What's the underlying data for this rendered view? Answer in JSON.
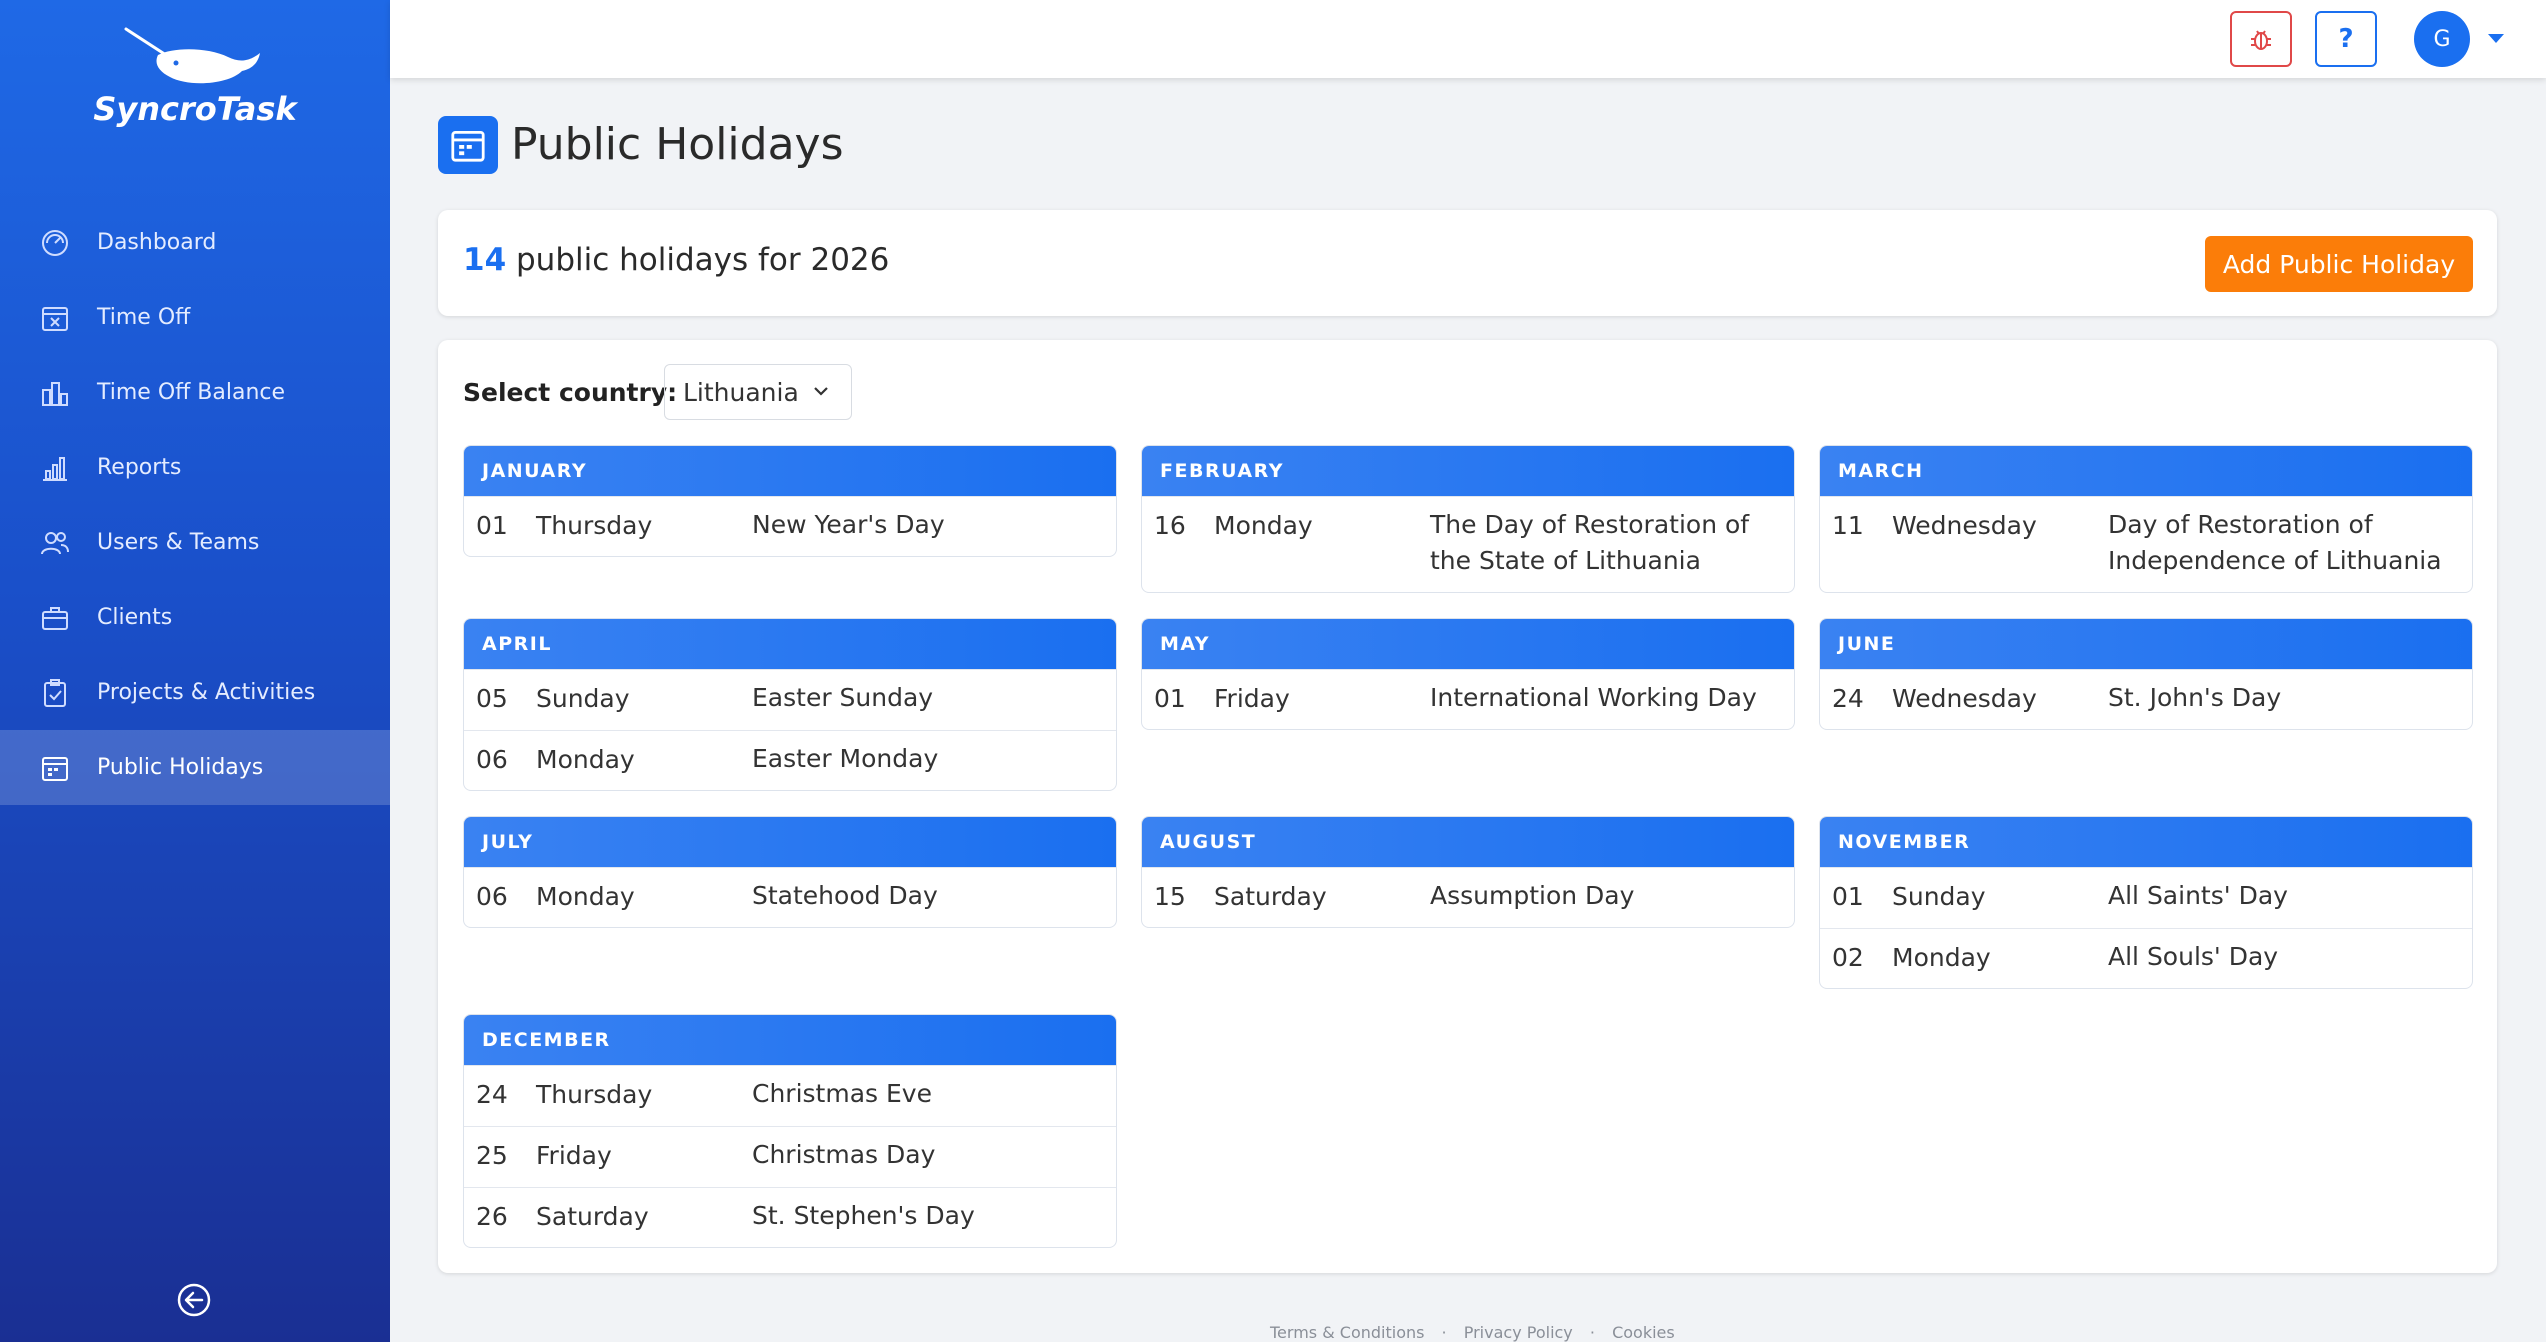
{
  "app": {
    "name": "SyncroTask"
  },
  "sidebar": {
    "items": [
      {
        "label": "Dashboard",
        "icon": "gauge-icon",
        "active": false
      },
      {
        "label": "Time Off",
        "icon": "calendar-x-icon",
        "active": false
      },
      {
        "label": "Time Off Balance",
        "icon": "balance-icon",
        "active": false
      },
      {
        "label": "Reports",
        "icon": "bar-chart-icon",
        "active": false
      },
      {
        "label": "Users & Teams",
        "icon": "users-icon",
        "active": false
      },
      {
        "label": "Clients",
        "icon": "briefcase-icon",
        "active": false
      },
      {
        "label": "Projects & Activities",
        "icon": "clipboard-check-icon",
        "active": false
      },
      {
        "label": "Public Holidays",
        "icon": "calendar-grid-icon",
        "active": true
      }
    ],
    "collapse_icon": "arrow-left-circle-icon"
  },
  "header": {
    "help_label": "?",
    "avatar_initial": "G",
    "colors": {
      "bug": "#e04848",
      "accent": "#1a6ff0"
    }
  },
  "page": {
    "title": "Public Holidays"
  },
  "summary": {
    "count": "14",
    "text": "public holidays for 2026",
    "add_button": "Add Public Holiday",
    "button_color": "#fb7d09"
  },
  "filter": {
    "label": "Select country:",
    "value": "Lithuania"
  },
  "months": [
    {
      "name": "JANUARY",
      "holidays": [
        {
          "day": "01",
          "weekday": "Thursday",
          "name": "New Year's Day"
        }
      ]
    },
    {
      "name": "FEBRUARY",
      "holidays": [
        {
          "day": "16",
          "weekday": "Monday",
          "name": "The Day of Restoration of the State of Lithuania"
        }
      ]
    },
    {
      "name": "MARCH",
      "holidays": [
        {
          "day": "11",
          "weekday": "Wednesday",
          "name": "Day of Restoration of Independence of Lithuania"
        }
      ]
    },
    {
      "name": "APRIL",
      "holidays": [
        {
          "day": "05",
          "weekday": "Sunday",
          "name": "Easter Sunday"
        },
        {
          "day": "06",
          "weekday": "Monday",
          "name": "Easter Monday"
        }
      ]
    },
    {
      "name": "MAY",
      "holidays": [
        {
          "day": "01",
          "weekday": "Friday",
          "name": "International Working Day"
        }
      ]
    },
    {
      "name": "JUNE",
      "holidays": [
        {
          "day": "24",
          "weekday": "Wednesday",
          "name": "St. John's Day"
        }
      ]
    },
    {
      "name": "JULY",
      "holidays": [
        {
          "day": "06",
          "weekday": "Monday",
          "name": "Statehood Day"
        }
      ]
    },
    {
      "name": "AUGUST",
      "holidays": [
        {
          "day": "15",
          "weekday": "Saturday",
          "name": "Assumption Day"
        }
      ]
    },
    {
      "name": "NOVEMBER",
      "holidays": [
        {
          "day": "01",
          "weekday": "Sunday",
          "name": "All Saints' Day"
        },
        {
          "day": "02",
          "weekday": "Monday",
          "name": "All Souls' Day"
        }
      ]
    },
    {
      "name": "DECEMBER",
      "holidays": [
        {
          "day": "24",
          "weekday": "Thursday",
          "name": "Christmas Eve"
        },
        {
          "day": "25",
          "weekday": "Friday",
          "name": "Christmas Day"
        },
        {
          "day": "26",
          "weekday": "Saturday",
          "name": "St. Stephen's Day"
        }
      ]
    }
  ],
  "footer": {
    "links": [
      "Terms & Conditions",
      "Privacy Policy",
      "Cookies"
    ],
    "separator": "·"
  }
}
